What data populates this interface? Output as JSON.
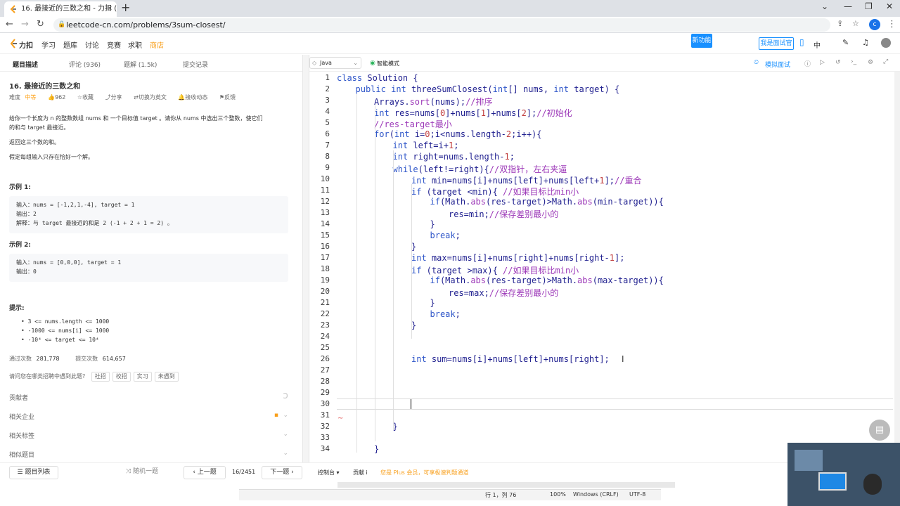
{
  "browser": {
    "tab_title": "16. 最接近的三数之和 - 力扣 (L",
    "url": "leetcode-cn.com/problems/3sum-closest/",
    "profile_initial": "c"
  },
  "site_nav": {
    "logo": "力扣",
    "items": [
      "学习",
      "题库",
      "讨论",
      "竞赛",
      "求职",
      "商店"
    ],
    "new_badge": "新功能",
    "interview_btn": "我是面试官",
    "lang": "中"
  },
  "left_tabs": [
    "题目描述",
    "评论 (936)",
    "题解 (1.5k)",
    "提交记录"
  ],
  "problem": {
    "title": "16. 最接近的三数之和",
    "difficulty_label": "难度",
    "difficulty": "中等",
    "likes": "962",
    "collect": "收藏",
    "share": "分享",
    "switch_en": "切换为英文",
    "notify": "接收动态",
    "feedback": "反馈",
    "desc_1": "给你一个长度为 n 的整数数组 nums 和 一个目标值 target 。请你从 nums 中选出三个整数，使它们",
    "desc_2": "的和与 target 最接近。",
    "desc_3": "返回这三个数的和。",
    "desc_4": "假定每组输入只存在恰好一个解。",
    "ex1_title": "示例 1:",
    "ex1_in": "输入：nums = [-1,2,1,-4], target = 1",
    "ex1_out": "输出：2",
    "ex1_exp": "解释：与 target 最接近的和是 2 (-1 + 2 + 1 = 2) 。",
    "ex2_title": "示例 2:",
    "ex2_in": "输入：nums = [0,0,0], target = 1",
    "ex2_out": "输出：0",
    "hint_title": "提示:",
    "hints": [
      "3 <= nums.length <= 1000",
      "-1000 <= nums[i] <= 1000",
      "-10⁴ <= target <= 10⁴"
    ],
    "passed_label": "通过次数",
    "passed": "281,778",
    "submitted_label": "提交次数",
    "submitted": "614,657",
    "met_q": "请问您在哪类招聘中遇到此题?",
    "met_tags": [
      "社招",
      "校招",
      "实习",
      "未遇到"
    ],
    "sections": [
      "贡献者",
      "相关企业",
      "相关标签",
      "相似题目"
    ]
  },
  "bottom": {
    "problem_list": "题目列表",
    "random": "随机一题",
    "prev": "上一题",
    "page": "16/2451",
    "next": "下一题",
    "console": "控制台",
    "contribute": "贡献 i",
    "plus_msg": "您是 Plus 会员，可享极速判题通道"
  },
  "editor": {
    "language": "Java",
    "smart_mode": "智能模式",
    "mock_interview": "模拟面试",
    "status_pos": "行 1，列 76",
    "zoom": "100%",
    "eol": "Windows (CRLF)",
    "encoding": "UTF-8"
  }
}
